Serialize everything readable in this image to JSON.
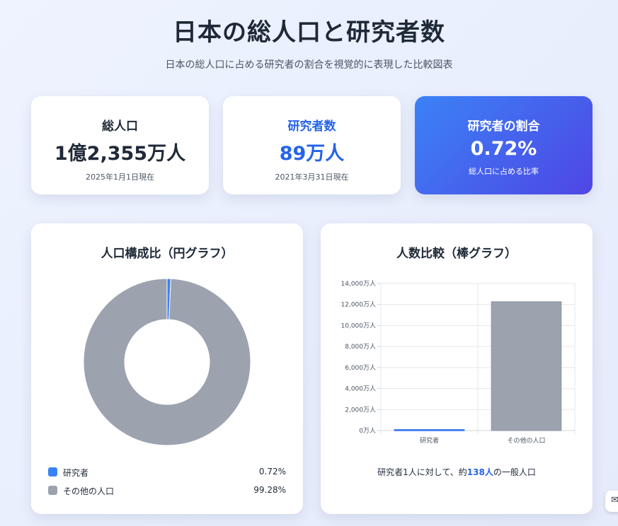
{
  "header": {
    "title": "日本の総人口と研究者数",
    "subtitle": "日本の総人口に占める研究者の割合を視覚的に表現した比較図表"
  },
  "stats": {
    "total": {
      "label": "総人口",
      "value": "1億2,355万人",
      "note": "2025年1月1日現在"
    },
    "researchers": {
      "label": "研究者数",
      "value": "89万人",
      "note": "2021年3月31日現在"
    },
    "ratio": {
      "label": "研究者の割合",
      "value": "0.72%",
      "note": "総人口に占める比率"
    }
  },
  "colors": {
    "researchers": "#3b82f6",
    "others": "#9ca3af",
    "accent": "#2563eb"
  },
  "chart_data": [
    {
      "type": "pie",
      "title": "人口構成比（円グラフ）",
      "categories": [
        "研究者",
        "その他の人口"
      ],
      "values": [
        0.72,
        99.28
      ],
      "value_labels": [
        "0.72%",
        "99.28%"
      ],
      "donut": true,
      "legend": "bottom"
    },
    {
      "type": "bar",
      "title": "人数比較（棒グラフ）",
      "categories": [
        "研究者",
        "その他の人口"
      ],
      "values": [
        89,
        12266
      ],
      "ylim": [
        0,
        14000
      ],
      "yticks": [
        0,
        2000,
        4000,
        6000,
        8000,
        10000,
        12000,
        14000
      ],
      "ytick_labels": [
        "0万人",
        "2,000万人",
        "4,000万人",
        "6,000万人",
        "8,000万人",
        "10,000万人",
        "12,000万人",
        "14,000万人"
      ],
      "grid": true,
      "caption": {
        "prefix": "研究者1人に対して、約",
        "highlight": "138人",
        "suffix": "の一般人口"
      }
    }
  ]
}
